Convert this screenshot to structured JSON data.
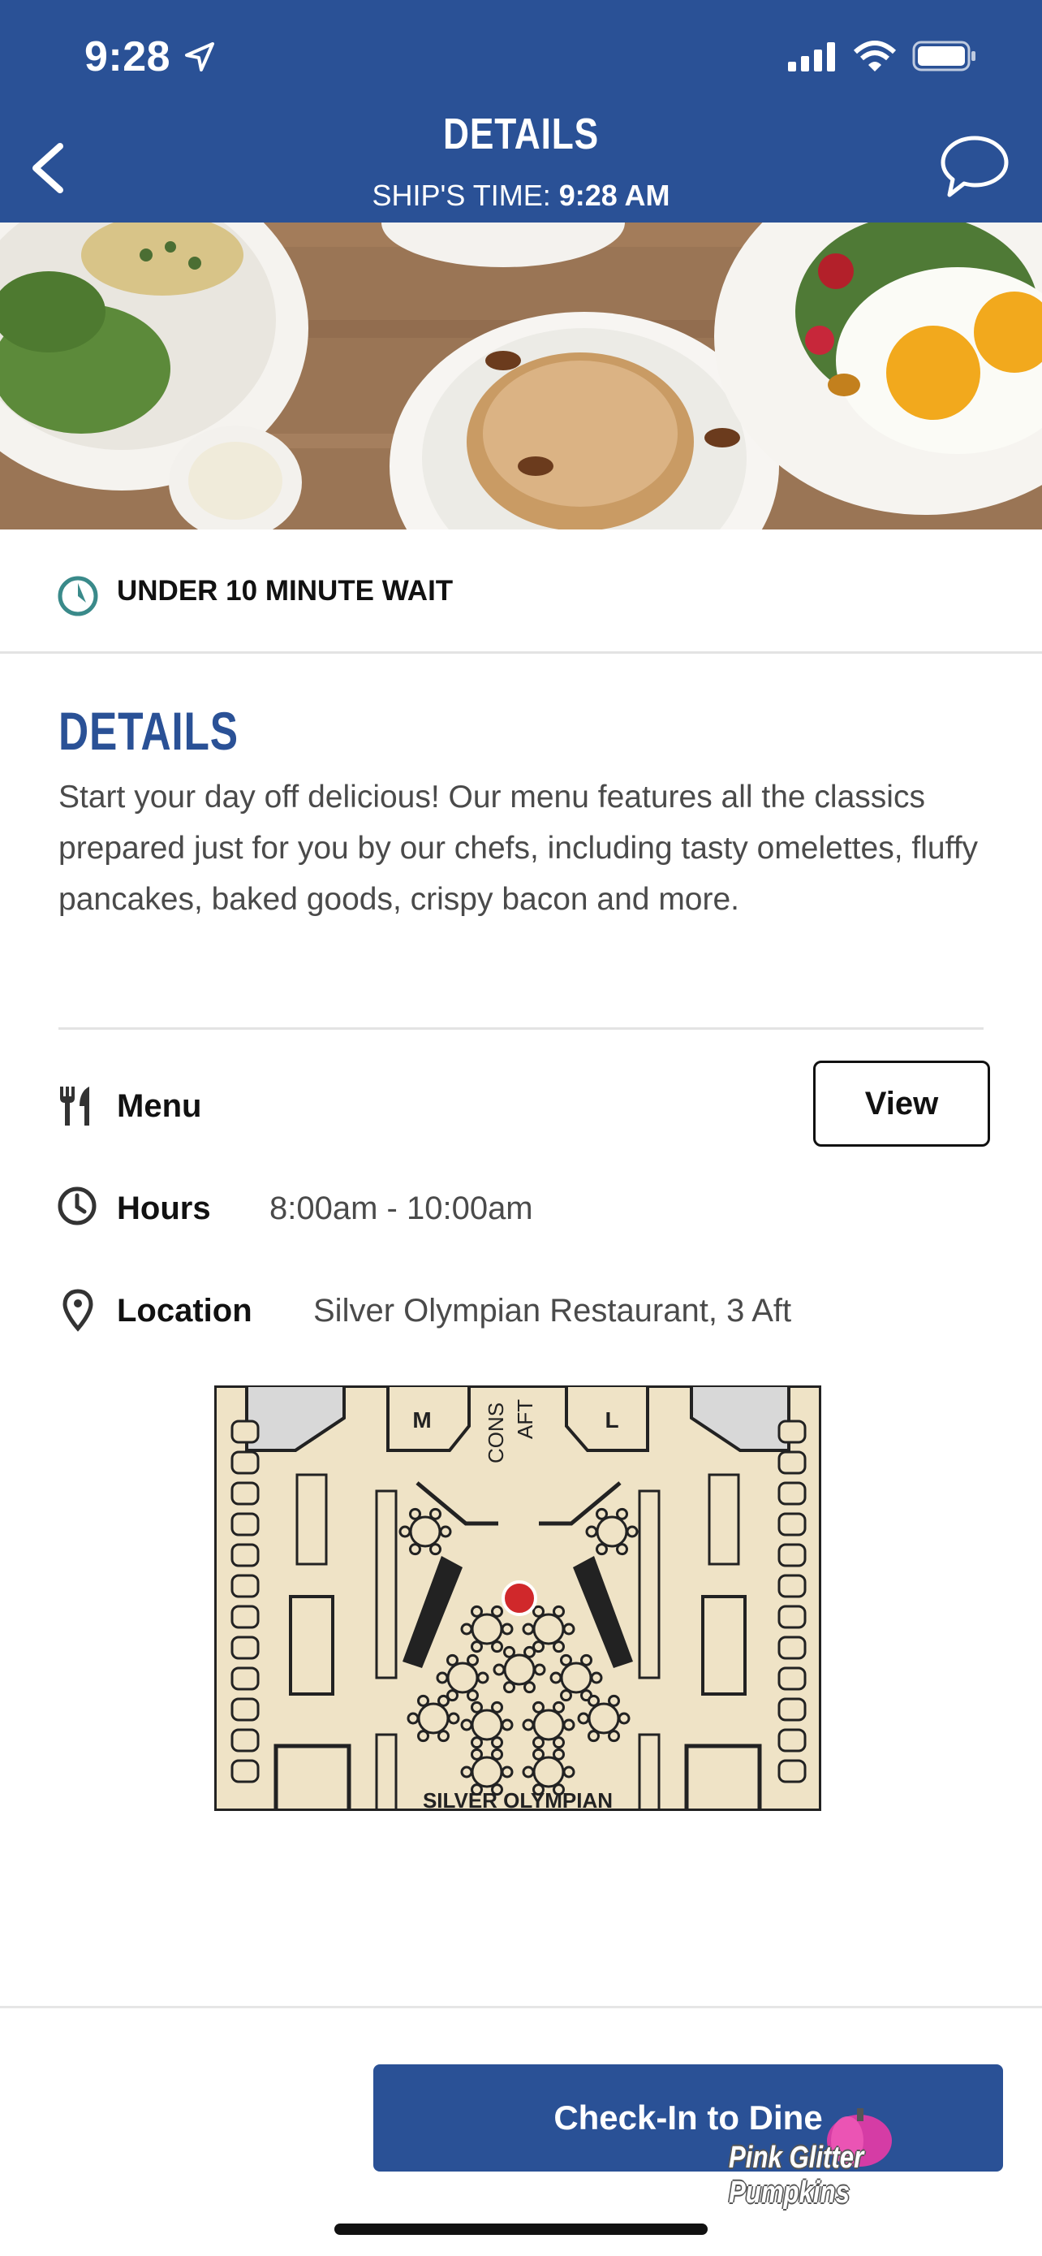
{
  "status_bar": {
    "time": "9:28",
    "icons": [
      "location-arrow-icon",
      "cellular-signal-icon",
      "wifi-icon",
      "battery-icon"
    ]
  },
  "nav": {
    "title": "DETAILS",
    "ship_time_label": "SHIP'S TIME: ",
    "ship_time_value": "9:28 AM",
    "back_icon": "chevron-left-icon",
    "chat_icon": "chat-bubble-icon"
  },
  "wait": {
    "text": "UNDER 10 MINUTE WAIT",
    "icon": "clock-icon"
  },
  "details": {
    "title": "DETAILS",
    "description": "Start your day off delicious! Our menu features all the classics prepared just for you by our chefs, including tasty omelettes, fluffy pancakes, baked goods, crispy bacon and more."
  },
  "info": {
    "menu_label": "Menu",
    "menu_button": "View",
    "hours_label": "Hours",
    "hours_value": "8:00am - 10:00am",
    "location_label": "Location",
    "location_value": "Silver Olympian Restaurant, 3 Aft"
  },
  "map": {
    "labels": [
      "M",
      "L",
      "CONS",
      "AFT",
      "SILVER OLYMPIAN"
    ]
  },
  "footer": {
    "checkin_button": "Check-In to Dine",
    "watermark": "Pink Glitter Pumpkins"
  },
  "colors": {
    "brand_blue": "#2a5196",
    "teal_clock": "#3a8a8a",
    "map_floor": "#efe3c6",
    "map_marker": "#d0282b"
  }
}
